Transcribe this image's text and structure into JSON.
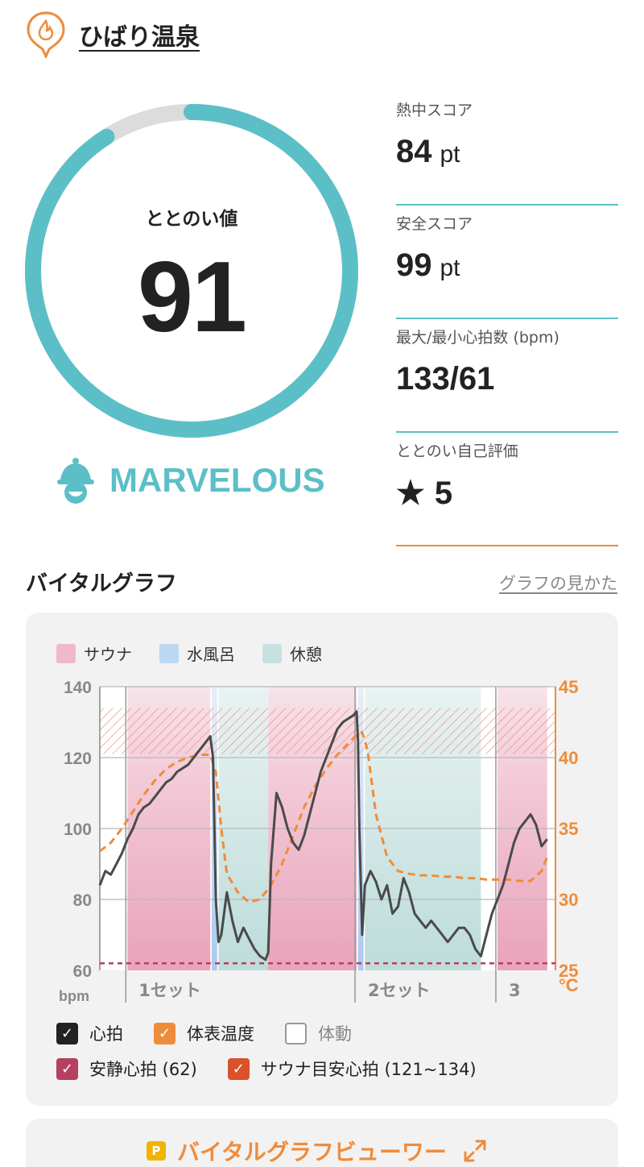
{
  "header": {
    "title": "ひばり温泉"
  },
  "gauge": {
    "label": "ととのい値",
    "value": "91",
    "fraction": 0.91
  },
  "rank": {
    "text": "MARVELOUS"
  },
  "stats": [
    {
      "label": "熱中スコア",
      "value": "84",
      "unit": "pt"
    },
    {
      "label": "安全スコア",
      "value": "99",
      "unit": "pt"
    },
    {
      "label": "最大/最小心拍数 (bpm)",
      "value": "133/61",
      "unit": ""
    },
    {
      "label": "ととのい自己評価",
      "value": "5",
      "unit": "",
      "star": "★"
    }
  ],
  "section": {
    "title": "バイタルグラフ",
    "link": "グラフの見かた"
  },
  "legend": [
    {
      "label": "サウナ",
      "color": "#f0b9c9"
    },
    {
      "label": "水風呂",
      "color": "#bcd7f2"
    },
    {
      "label": "休憩",
      "color": "#c5e2e0"
    }
  ],
  "chart_data": {
    "type": "line",
    "y_left": {
      "ticks": [
        "140",
        "120",
        "100",
        "80",
        "60"
      ],
      "unit": "bpm",
      "range": [
        60,
        140
      ]
    },
    "y_right": {
      "ticks": [
        "45",
        "40",
        "35",
        "30",
        "25"
      ],
      "unit": "°C",
      "range": [
        25,
        45
      ]
    },
    "set_labels": [
      "1セット",
      "2セット",
      "3"
    ],
    "phases": [
      {
        "type": "sauna",
        "start": 0.1,
        "end": 0.4
      },
      {
        "type": "cold",
        "start": 0.405,
        "end": 0.425
      },
      {
        "type": "rest",
        "start": 0.43,
        "end": 0.61
      },
      {
        "type": "sauna",
        "start": 0.61,
        "end": 0.93
      },
      {
        "type": "cold",
        "start": 0.935,
        "end": 0.955
      },
      {
        "type": "rest",
        "start": 0.96,
        "end": 1.38
      },
      {
        "type": "sauna",
        "start": 1.44,
        "end": 1.62
      }
    ],
    "sauna_target_band": [
      121,
      134
    ],
    "resting_hr": 62,
    "heart_rate": {
      "x": [
        0.0,
        0.02,
        0.04,
        0.06,
        0.08,
        0.1,
        0.12,
        0.14,
        0.16,
        0.18,
        0.2,
        0.22,
        0.24,
        0.26,
        0.28,
        0.3,
        0.32,
        0.34,
        0.36,
        0.38,
        0.4,
        0.41,
        0.415,
        0.42,
        0.43,
        0.44,
        0.46,
        0.48,
        0.5,
        0.52,
        0.54,
        0.56,
        0.58,
        0.6,
        0.61,
        0.62,
        0.64,
        0.66,
        0.68,
        0.7,
        0.72,
        0.74,
        0.76,
        0.78,
        0.8,
        0.82,
        0.84,
        0.86,
        0.88,
        0.9,
        0.92,
        0.93,
        0.935,
        0.94,
        0.95,
        0.96,
        0.98,
        1.0,
        1.02,
        1.04,
        1.06,
        1.08,
        1.1,
        1.12,
        1.14,
        1.16,
        1.18,
        1.2,
        1.22,
        1.24,
        1.26,
        1.28,
        1.3,
        1.32,
        1.34,
        1.36,
        1.38,
        1.4,
        1.42,
        1.44,
        1.46,
        1.48,
        1.5,
        1.52,
        1.54,
        1.56,
        1.58,
        1.6,
        1.62
      ],
      "y": [
        84,
        88,
        87,
        90,
        93,
        97,
        100,
        104,
        106,
        107,
        109,
        111,
        113,
        114,
        116,
        117,
        118,
        120,
        122,
        124,
        126,
        120,
        100,
        80,
        68,
        70,
        82,
        74,
        68,
        72,
        69,
        66,
        64,
        63,
        65,
        90,
        110,
        106,
        100,
        96,
        94,
        98,
        104,
        110,
        116,
        120,
        124,
        128,
        130,
        131,
        132,
        133,
        125,
        100,
        70,
        84,
        88,
        85,
        80,
        84,
        76,
        78,
        86,
        82,
        76,
        74,
        72,
        74,
        72,
        70,
        68,
        70,
        72,
        72,
        70,
        66,
        64,
        70,
        76,
        80,
        84,
        90,
        96,
        100,
        102,
        104,
        101,
        95,
        97
      ]
    },
    "skin_temp": {
      "x": [
        0.0,
        0.04,
        0.08,
        0.12,
        0.16,
        0.2,
        0.24,
        0.28,
        0.32,
        0.36,
        0.4,
        0.42,
        0.44,
        0.46,
        0.5,
        0.54,
        0.58,
        0.62,
        0.66,
        0.7,
        0.74,
        0.78,
        0.82,
        0.86,
        0.9,
        0.93,
        0.95,
        0.97,
        1.0,
        1.04,
        1.08,
        1.12,
        1.16,
        1.2,
        1.24,
        1.28,
        1.32,
        1.36,
        1.4,
        1.44,
        1.48,
        1.52,
        1.56,
        1.6,
        1.62
      ],
      "y": [
        33.4,
        34.0,
        35.0,
        36.2,
        37.4,
        38.4,
        39.2,
        39.7,
        40.0,
        40.2,
        40.2,
        39.0,
        35.0,
        31.8,
        30.5,
        29.8,
        30.0,
        31.0,
        32.5,
        34.5,
        36.5,
        38.0,
        39.2,
        40.2,
        41.0,
        41.6,
        41.8,
        40.5,
        36.0,
        33.0,
        32.0,
        31.8,
        31.7,
        31.7,
        31.6,
        31.6,
        31.5,
        31.5,
        31.4,
        31.4,
        31.4,
        31.3,
        31.3,
        32.0,
        33.0
      ]
    },
    "series": [
      {
        "name": "心拍",
        "color": "#222222"
      },
      {
        "name": "体表温度",
        "color": "#ef8c3a"
      }
    ]
  },
  "checks": {
    "row1": [
      {
        "label": "心拍",
        "checked": true,
        "color": "#222222"
      },
      {
        "label": "体表温度",
        "checked": true,
        "color": "#ef8c3a"
      },
      {
        "label": "体動",
        "checked": false,
        "color": "#999999"
      }
    ],
    "row2": [
      {
        "label": "安静心拍 (62)",
        "checked": true,
        "color": "#b5405f"
      },
      {
        "label": "サウナ目安心拍 (121~134)",
        "checked": true,
        "color": "#d9522a"
      }
    ]
  },
  "viewer": {
    "badge": "P",
    "label": "バイタルグラフビューワー"
  },
  "colors": {
    "accent": "#5cbfc7",
    "orange": "#ef8c3a",
    "gauge_track": "#dcdcdc"
  }
}
